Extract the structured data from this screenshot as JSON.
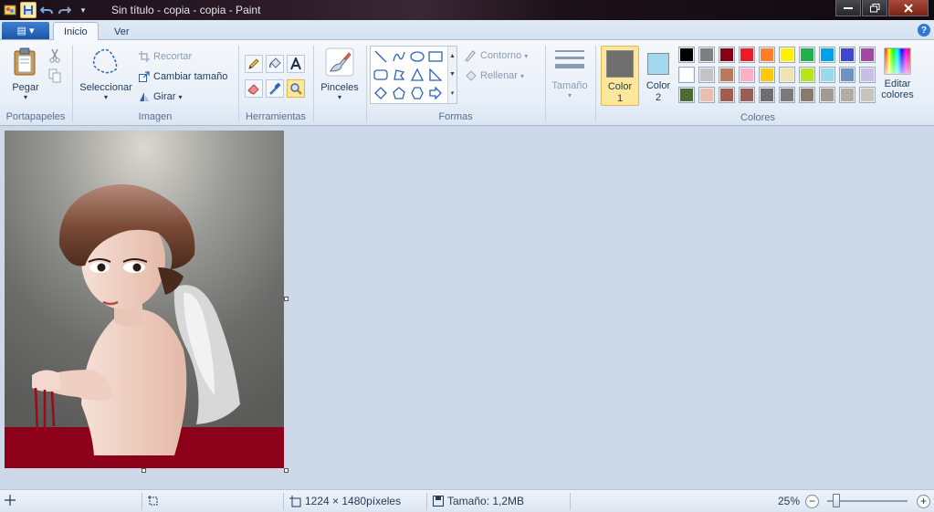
{
  "titlebar": {
    "title": "Sin título - copia - copia - Paint",
    "quick_access": [
      "app-icon",
      "save-icon",
      "undo-icon",
      "redo-icon",
      "customize-dropdown"
    ],
    "window_buttons": [
      "minimize",
      "maximize",
      "close"
    ]
  },
  "tabs": {
    "app_menu": "▤ ▾",
    "items": [
      {
        "label": "Inicio",
        "active": true
      },
      {
        "label": "Ver",
        "active": false
      }
    ],
    "help": "?"
  },
  "ribbon": {
    "portapapeles": {
      "label": "Portapapeles",
      "paste": "Pegar"
    },
    "imagen": {
      "label": "Imagen",
      "select": "Seleccionar",
      "crop": "Recortar",
      "resize": "Cambiar tamaño",
      "rotate": "Girar"
    },
    "herramientas": {
      "label": "Herramientas",
      "tools": [
        "pencil",
        "fill",
        "text",
        "eraser",
        "color-picker",
        "magnifier"
      ],
      "selected": "magnifier"
    },
    "pinceles": {
      "label": "Pinceles"
    },
    "formas": {
      "label": "Formas",
      "outline": "Contorno",
      "fill": "Rellenar"
    },
    "tamano": {
      "label": "Tamaño"
    },
    "colores": {
      "label": "Colores",
      "color1_label": "Color",
      "color1_num": "1",
      "color2_label": "Color",
      "color2_num": "2",
      "color1": "#6f6f6f",
      "color2": "#a3d9ef",
      "edit_label_1": "Editar",
      "edit_label_2": "colores",
      "palette": [
        "#000000",
        "#7f7f7f",
        "#880015",
        "#ed1c24",
        "#ff7f27",
        "#fff200",
        "#22b14c",
        "#00a2e8",
        "#3f48cc",
        "#a349a4",
        "#ffffff",
        "#c3c3c3",
        "#b97a57",
        "#ffaec9",
        "#ffc90e",
        "#efe4b0",
        "#b5e61d",
        "#99d9ea",
        "#7092be",
        "#c8bfe7",
        "#4e6b35",
        "#e8bfae",
        "#a45a4f",
        "#9b5c55",
        "#6e6e6e",
        "#7a7a7a",
        "#8a7a6d",
        "#a29a90",
        "#b3aca2",
        "#c8c4bc"
      ]
    }
  },
  "statusbar": {
    "dimensions": "1224 × 1480píxeles",
    "size": "Tamaño: 1,2MB",
    "zoom": "25%",
    "zoom_minus": "−",
    "zoom_plus": "+"
  }
}
